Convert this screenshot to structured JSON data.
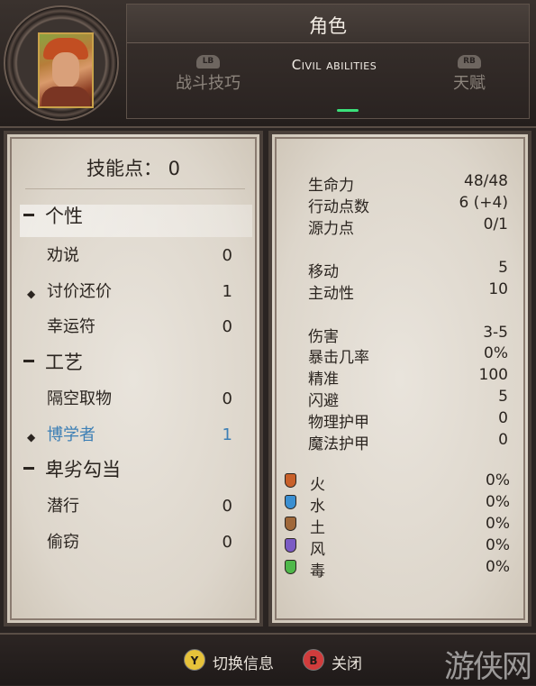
{
  "header": {
    "title": "角色",
    "tabs": [
      {
        "badge": "LB",
        "label": "战斗技巧"
      },
      {
        "label": "Civil abilities"
      },
      {
        "badge": "RB",
        "label": "天赋"
      }
    ]
  },
  "left": {
    "skill_points_label": "技能点：  0",
    "categories": [
      {
        "name": "个性",
        "skills": [
          {
            "name": "劝说",
            "value": "0"
          },
          {
            "name": "讨价还价",
            "value": "1"
          },
          {
            "name": "幸运符",
            "value": "0"
          }
        ]
      },
      {
        "name": "工艺",
        "skills": [
          {
            "name": "隔空取物",
            "value": "0"
          },
          {
            "name": "博学者",
            "value": "1"
          }
        ]
      },
      {
        "name": "卑劣勾当",
        "skills": [
          {
            "name": "潜行",
            "value": "0"
          },
          {
            "name": "偷窃",
            "value": "0"
          }
        ]
      }
    ]
  },
  "right": {
    "stats": [
      {
        "name": "生命力",
        "value": "48/48"
      },
      {
        "name": "行动点数",
        "value": "6 (+4)"
      },
      {
        "name": "源力点",
        "value": "0/1"
      },
      {
        "name": "移动",
        "value": "5"
      },
      {
        "name": "主动性",
        "value": "10"
      },
      {
        "name": "伤害",
        "value": "3-5"
      },
      {
        "name": "暴击几率",
        "value": "0%"
      },
      {
        "name": "精准",
        "value": "100"
      },
      {
        "name": "闪避",
        "value": "5"
      },
      {
        "name": "物理护甲",
        "value": "0"
      },
      {
        "name": "魔法护甲",
        "value": "0"
      }
    ],
    "resistances": [
      {
        "name": "火",
        "value": "0%",
        "color": "#c8602a"
      },
      {
        "name": "水",
        "value": "0%",
        "color": "#3b8fd1"
      },
      {
        "name": "土",
        "value": "0%",
        "color": "#a0683a"
      },
      {
        "name": "风",
        "value": "0%",
        "color": "#7b5bc4"
      },
      {
        "name": "毒",
        "value": "0%",
        "color": "#4fb84a"
      }
    ]
  },
  "footer": {
    "hint_y": {
      "button": "Y",
      "label": "切换信息",
      "color": "#e6c23a"
    },
    "hint_b": {
      "button": "B",
      "label": "关闭",
      "color": "#d13c3c"
    }
  }
}
